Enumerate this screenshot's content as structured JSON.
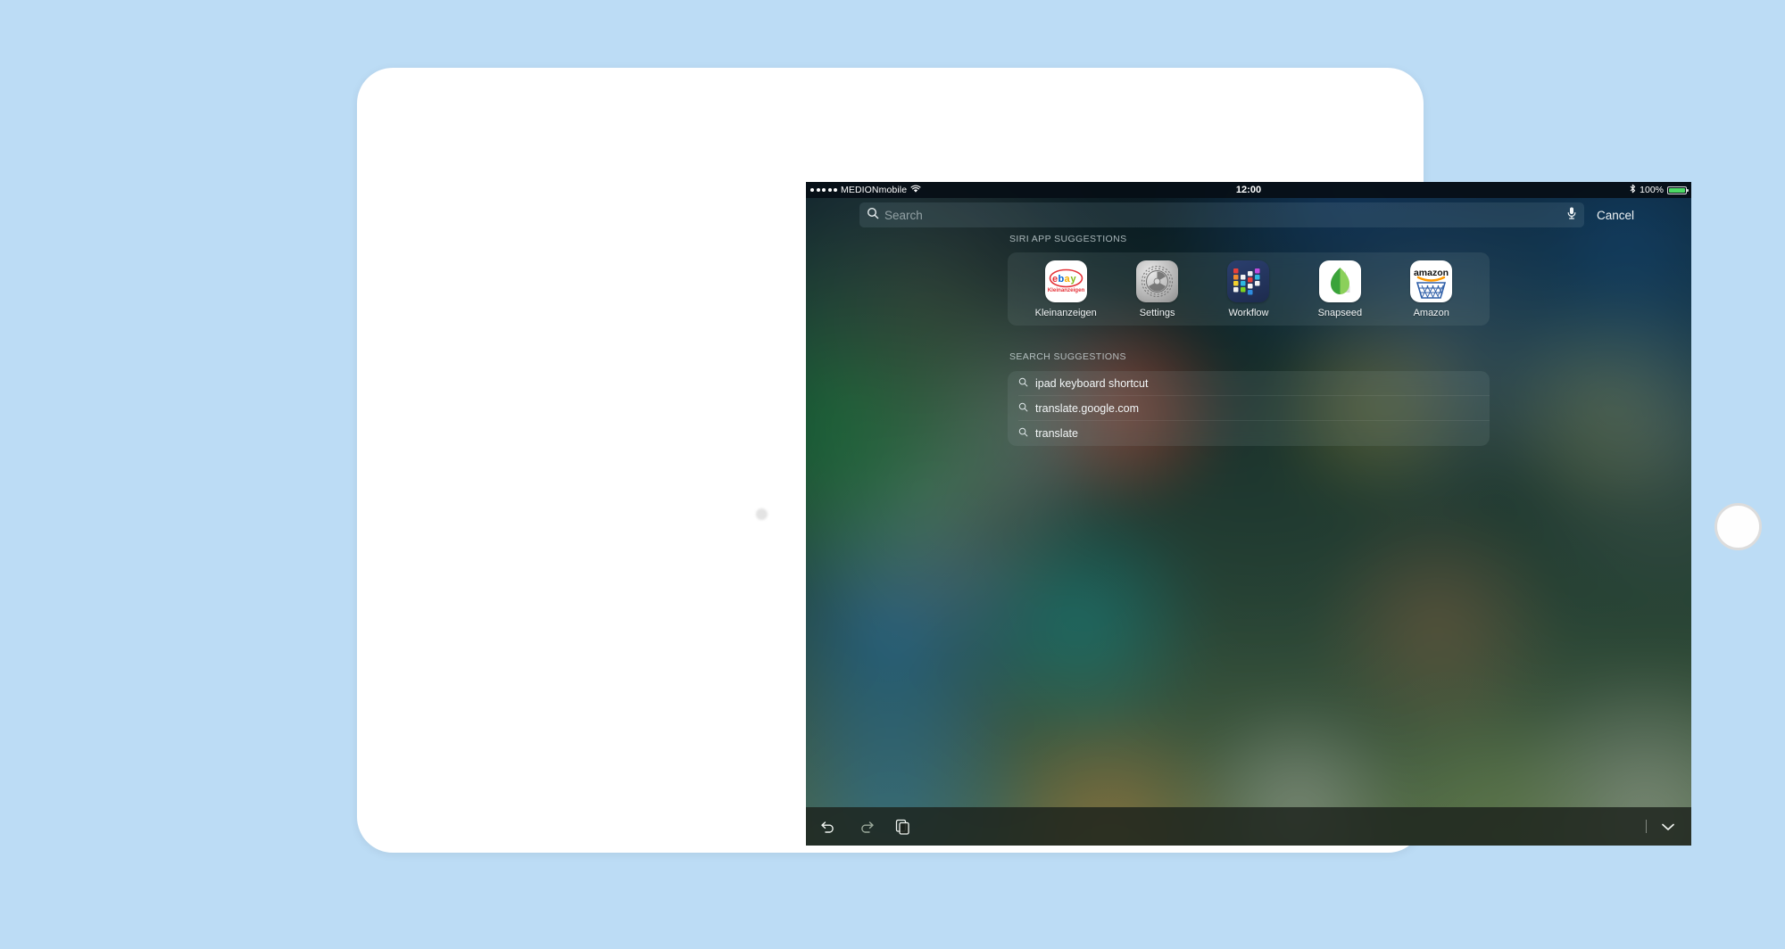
{
  "device": {
    "name": "tablet-frame",
    "home_button": "home-button",
    "camera": "front-camera"
  },
  "status_bar": {
    "signal_dots": 5,
    "carrier": "MEDIONmobile",
    "wifi_icon": "wifi-icon",
    "time": "12:00",
    "bluetooth_icon": "bluetooth-icon",
    "battery_percent": "100%",
    "battery_level": 100
  },
  "search": {
    "search_icon": "search-icon",
    "placeholder": "Search",
    "value": "",
    "mic_icon": "microphone-icon",
    "cancel_label": "Cancel"
  },
  "siri_suggestions": {
    "header": "SIRI APP SUGGESTIONS",
    "apps": [
      {
        "label": "Kleinanzeigen",
        "icon": "ebay-kleinanzeigen-icon"
      },
      {
        "label": "Settings",
        "icon": "settings-gear-icon"
      },
      {
        "label": "Workflow",
        "icon": "workflow-icon"
      },
      {
        "label": "Snapseed",
        "icon": "snapseed-icon"
      },
      {
        "label": "Amazon",
        "icon": "amazon-icon"
      }
    ]
  },
  "search_suggestions": {
    "header": "SEARCH SUGGESTIONS",
    "items": [
      {
        "text": "ipad keyboard shortcut",
        "icon": "search-icon"
      },
      {
        "text": "translate.google.com",
        "icon": "search-icon"
      },
      {
        "text": "translate",
        "icon": "search-icon"
      }
    ]
  },
  "toolbar": {
    "undo": "undo-icon",
    "redo": "redo-icon",
    "paste": "paste-icon",
    "hide_keyboard": "chevron-down-icon"
  },
  "colors": {
    "page_background": "#bcdcf5",
    "device_body": "#ffffff",
    "battery_green": "#4cd964",
    "text_primary": "#f2f6f7",
    "wallpaper_base": "#1d3a36"
  }
}
